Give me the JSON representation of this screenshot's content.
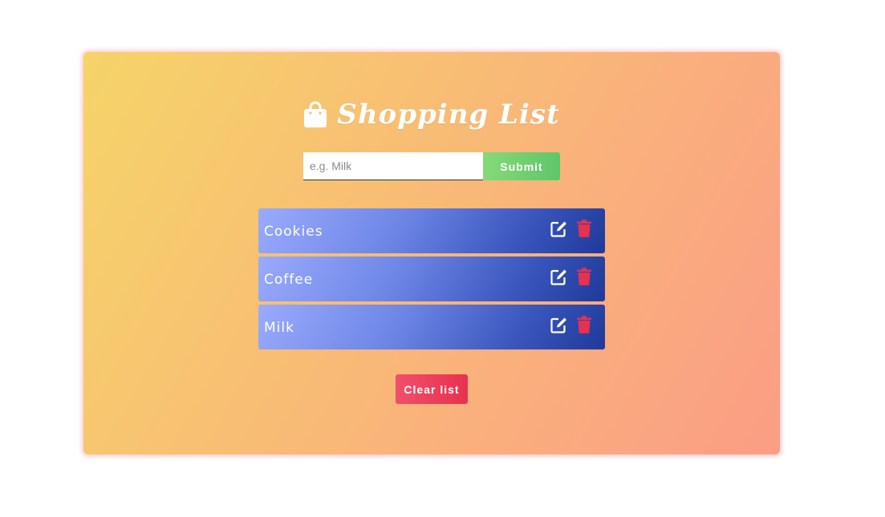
{
  "app": {
    "title": "Shopping List"
  },
  "form": {
    "input_placeholder": "e.g. Milk",
    "input_value": "",
    "submit_label": "Submit"
  },
  "items": [
    {
      "label": "Cookies",
      "edit_icon": "edit-icon",
      "delete_icon": "trash-icon"
    },
    {
      "label": "Coffee",
      "edit_icon": "edit-icon",
      "delete_icon": "trash-icon"
    },
    {
      "label": "Milk",
      "edit_icon": "edit-icon",
      "delete_icon": "trash-icon"
    }
  ],
  "actions": {
    "clear_label": "Clear list"
  },
  "icons": {
    "title_icon": "shopping-bag-icon"
  },
  "colors": {
    "submit": "#6ccf6e",
    "delete": "#e8314f",
    "item_start": "#9aabfd",
    "item_end": "#1f3a9a",
    "card_start": "#f5d468",
    "card_end": "#fb9d84"
  }
}
